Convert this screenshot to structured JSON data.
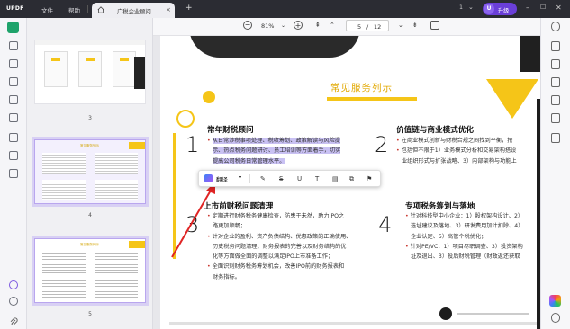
{
  "titlebar": {
    "logo": "UPDF",
    "menu": [
      "文件",
      "帮助"
    ],
    "tab_title": "广税企业顾问",
    "tab_close": "×",
    "new_tab": "+",
    "badge": "1",
    "avatar_letter": "U",
    "upgrade_label": "升级"
  },
  "toolbar": {
    "zoom_out": "−",
    "zoom": "81%",
    "zoom_in": "+",
    "page_current": "5",
    "page_sep": "/",
    "page_total": "12"
  },
  "thumbnails": [
    {
      "label": "3"
    },
    {
      "label": "4",
      "title": "常见服务列示"
    },
    {
      "label": "5",
      "title": "常见服务列示"
    }
  ],
  "slide": {
    "title": "常见服务列示",
    "accent_color": "#f5c518",
    "items": [
      {
        "num": "1",
        "title": "常年财税顾问",
        "lines_hl": [
          "从日常涉税事项处理、税收筹划、政策解读与风险提",
          "示、热点税务问题研讨、员工培训等方面着手，切实",
          "提高公司税务日常管理水平。"
        ]
      },
      {
        "num": "2",
        "title": "价值链与商业模式优化",
        "lines": [
          "在商业模式创新与财税合规之间找到平衡，抢",
          "包括但不限于1）业务模式分析和交易架构搭设",
          "业组织形式与扩张战略、3）内部架构与功能上"
        ]
      },
      {
        "num": "3",
        "title": "上市前财税问题清理",
        "lines": [
          "定期进行财务税务健康检查，防患于未然，助力IPO之",
          "路更加顺畅；",
          "针对企业的盈利、资产负债结构、优惠政策的正确使用、",
          "历史税务问题清理、财务报表的完善以及财务结构的优",
          "化等方面做全面的调整以满足IPO上市准备工作；",
          "全面识别财务税务筹划机会，改善IPO前的财务报表和",
          "财务指标。"
        ],
        "bullets": [
          0,
          2,
          5
        ]
      },
      {
        "num": "4",
        "title": "专项税务筹划与落地",
        "lines": [
          "针对科技型中小企业：1）股权架构设计、2）",
          "选址建议及落地、3）研发费用加计扣除、4）",
          "企业认定、5）高管个税优化；",
          "针对PE/VC：1）项目尽职调查、3）投资架构",
          "址及退出、3）投后财税管理（财政返还获取"
        ],
        "bullets": [
          0,
          3
        ]
      }
    ]
  },
  "quick_toolbar": {
    "translate_label": "翻译",
    "dropdown": "▾",
    "tools": [
      "highlighter-icon",
      "strikethrough-icon",
      "underline-icon",
      "text-icon",
      "comment-icon",
      "copy-icon",
      "bookmark-icon"
    ],
    "glyphs": [
      "✎",
      "S",
      "U",
      "T",
      "▤",
      "⧉",
      "⚑"
    ]
  }
}
